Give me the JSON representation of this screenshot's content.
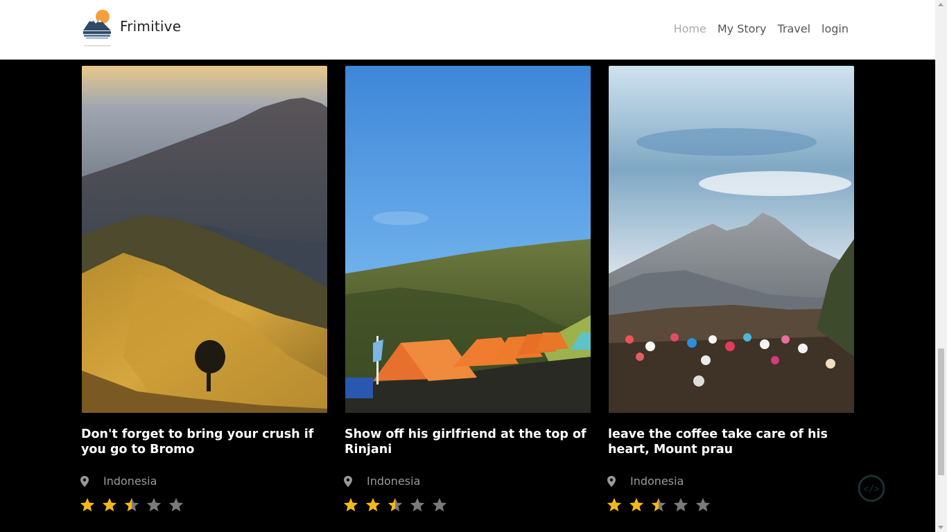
{
  "header": {
    "brand_name": "Frimitive",
    "logo_text": "Mountains",
    "nav": [
      {
        "label": "Home",
        "active": true
      },
      {
        "label": "My Story",
        "active": false
      },
      {
        "label": "Travel",
        "active": false
      },
      {
        "label": "login",
        "active": false
      }
    ]
  },
  "cards": [
    {
      "title": "Don't forget to bring your crush if you go to Bromo",
      "location": "Indonesia",
      "rating": 2.5,
      "rating_max": 5
    },
    {
      "title": "Show off his girlfriend at the top of Rinjani",
      "location": "Indonesia",
      "rating": 2.5,
      "rating_max": 5
    },
    {
      "title": "leave the coffee take care of his heart, Mount prau",
      "location": "Indonesia",
      "rating": 2.5,
      "rating_max": 5
    }
  ],
  "colors": {
    "star_filled": "#f4b819",
    "star_empty": "#7a7a7a",
    "nav_active": "#aaaaaa",
    "background": "#000000"
  }
}
